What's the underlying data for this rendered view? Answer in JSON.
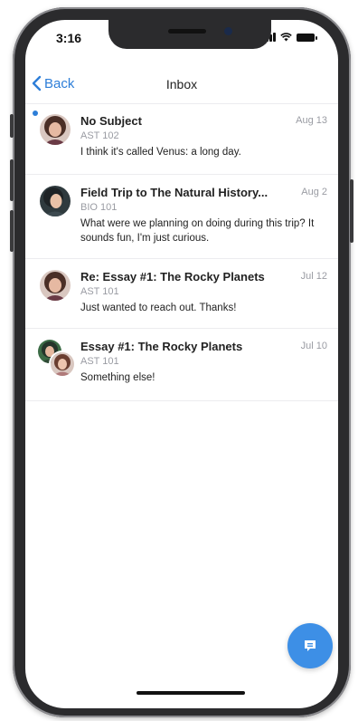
{
  "status_bar": {
    "time": "3:16",
    "icons": [
      "cellular-signal-icon",
      "wifi-icon",
      "battery-icon"
    ]
  },
  "nav": {
    "back_label": "Back",
    "title": "Inbox"
  },
  "messages": [
    {
      "subject": "No Subject",
      "course": "AST 102",
      "date": "Aug 13",
      "preview": "I think it's called Venus: a long day.",
      "unread": true
    },
    {
      "subject": "Field Trip to The Natural History...",
      "course": "BIO 101",
      "date": "Aug 2",
      "preview": "What were we planning on doing during this trip? It sounds fun, I'm just curious.",
      "unread": false
    },
    {
      "subject": "Re: Essay #1: The Rocky Planets",
      "course": "AST 101",
      "date": "Jul 12",
      "preview": "Just wanted to reach out. Thanks!",
      "unread": false
    },
    {
      "subject": "Essay #1: The Rocky Planets",
      "course": "AST 101",
      "date": "Jul 10",
      "preview": "Something else!",
      "unread": false
    }
  ],
  "compose_button": {
    "icon": "compose-message-icon"
  },
  "colors": {
    "accent": "#2d7ed8",
    "fab": "#3d8fe6",
    "secondary_text": "#9a9ca3",
    "divider": "#ececef"
  }
}
